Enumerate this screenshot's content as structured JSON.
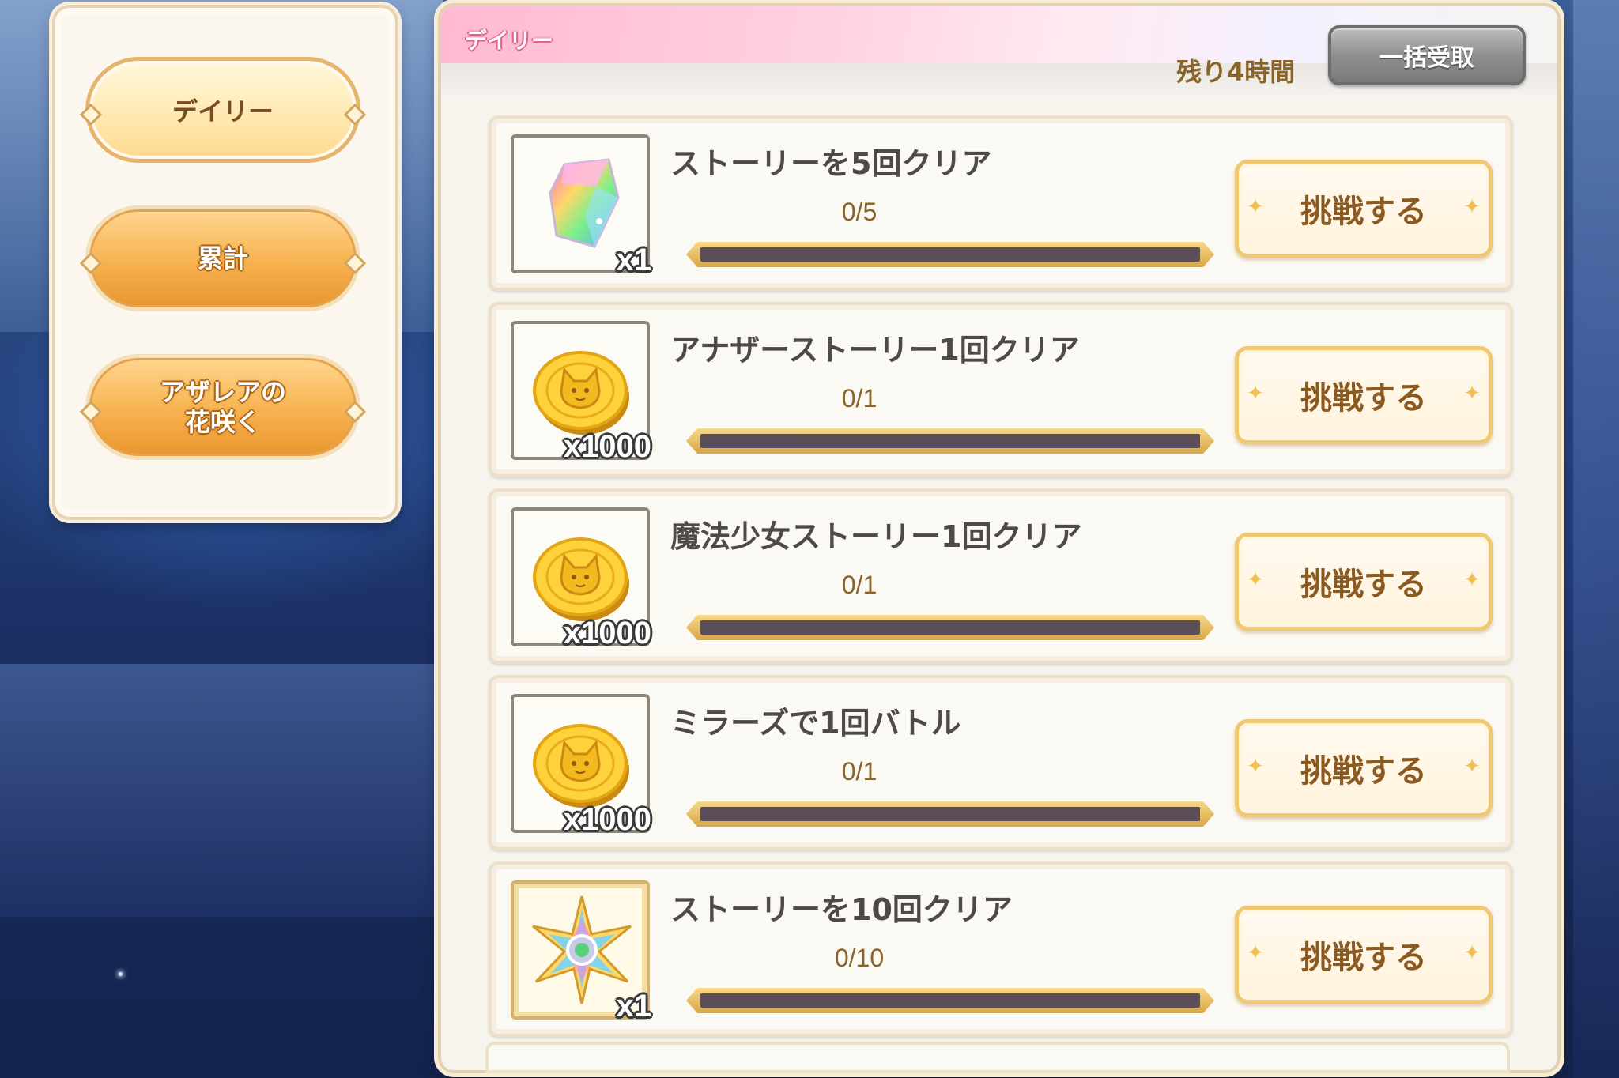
{
  "tabs": [
    {
      "label": "デイリー",
      "active": true
    },
    {
      "label": "累計",
      "active": false
    },
    {
      "label": "アザレアの\n花咲く",
      "active": false
    }
  ],
  "header": {
    "title": "デイリー",
    "time_remaining": "残り4時間",
    "claim_all_label": "一括受取"
  },
  "missions": [
    {
      "title": "ストーリーを5回クリア",
      "progress": "0/5",
      "progress_fraction": 0,
      "reward": "crystal-icon",
      "quantity": "x1",
      "button": "挑戦する"
    },
    {
      "title": "アナザーストーリー1回クリア",
      "progress": "0/1",
      "progress_fraction": 0,
      "reward": "gold-coin-icon",
      "quantity": "x1000",
      "button": "挑戦する"
    },
    {
      "title": "魔法少女ストーリー1回クリア",
      "progress": "0/1",
      "progress_fraction": 0,
      "reward": "gold-coin-icon",
      "quantity": "x1000",
      "button": "挑戦する"
    },
    {
      "title": "ミラーズで1回バトル",
      "progress": "0/1",
      "progress_fraction": 0,
      "reward": "gold-coin-icon",
      "quantity": "x1000",
      "button": "挑戦する"
    },
    {
      "title": "ストーリーを10回クリア",
      "progress": "0/10",
      "progress_fraction": 0,
      "reward": "star-gem-icon",
      "quantity": "x1",
      "button": "挑戦する"
    }
  ],
  "colors": {
    "accent_gold": "#f1c872",
    "text_brown": "#8a6328",
    "header_pink": "#ffb9d3",
    "progress_track": "#5b4e58"
  }
}
